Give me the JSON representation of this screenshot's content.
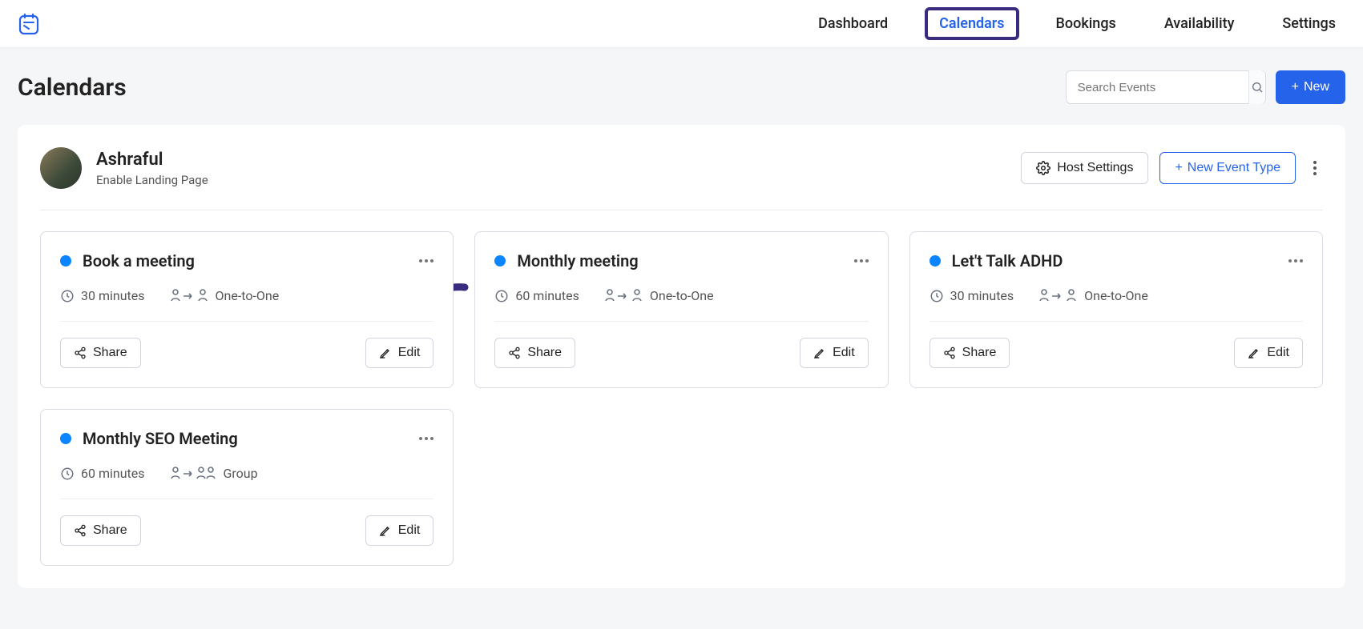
{
  "nav": {
    "dashboard": "Dashboard",
    "calendars": "Calendars",
    "bookings": "Bookings",
    "availability": "Availability",
    "settings": "Settings"
  },
  "page": {
    "title": "Calendars",
    "searchPlaceholder": "Search Events",
    "newLabel": "New"
  },
  "host": {
    "name": "Ashraful",
    "sub": "Enable Landing Page",
    "hostSettings": "Host Settings",
    "newEventType": "New Event Type"
  },
  "labels": {
    "share": "Share",
    "edit": "Edit"
  },
  "events": [
    {
      "title": "Book a meeting",
      "duration": "30 minutes",
      "type": "One-to-One",
      "typeKind": "one"
    },
    {
      "title": "Monthly meeting",
      "duration": "60 minutes",
      "type": "One-to-One",
      "typeKind": "one"
    },
    {
      "title": "Let't Talk ADHD",
      "duration": "30 minutes",
      "type": "One-to-One",
      "typeKind": "one"
    },
    {
      "title": "Monthly SEO Meeting",
      "duration": "60 minutes",
      "type": "Group",
      "typeKind": "group"
    }
  ]
}
